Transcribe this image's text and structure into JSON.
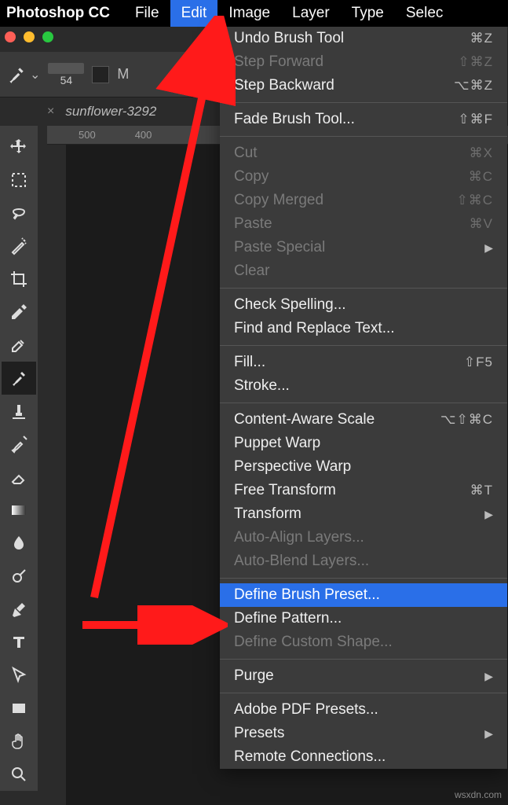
{
  "menubar": {
    "app": "Photoshop CC",
    "items": [
      "File",
      "Edit",
      "Image",
      "Layer",
      "Type",
      "Selec"
    ],
    "activeIndex": 1
  },
  "options": {
    "brushSize": "54",
    "modeLetter": "M"
  },
  "tab": {
    "close": "×",
    "title": "sunflower-3292"
  },
  "ruler": {
    "t0": "500",
    "t1": "400"
  },
  "dropdown": {
    "items": [
      {
        "label": "Undo Brush Tool",
        "shortcut": "⌘Z",
        "enabled": true
      },
      {
        "label": "Step Forward",
        "shortcut": "⇧⌘Z",
        "enabled": false
      },
      {
        "label": "Step Backward",
        "shortcut": "⌥⌘Z",
        "enabled": true
      },
      {
        "sep": true
      },
      {
        "label": "Fade Brush Tool...",
        "shortcut": "⇧⌘F",
        "enabled": true
      },
      {
        "sep": true
      },
      {
        "label": "Cut",
        "shortcut": "⌘X",
        "enabled": false
      },
      {
        "label": "Copy",
        "shortcut": "⌘C",
        "enabled": false
      },
      {
        "label": "Copy Merged",
        "shortcut": "⇧⌘C",
        "enabled": false
      },
      {
        "label": "Paste",
        "shortcut": "⌘V",
        "enabled": false
      },
      {
        "label": "Paste Special",
        "shortcut": "▶",
        "enabled": false
      },
      {
        "label": "Clear",
        "shortcut": "",
        "enabled": false
      },
      {
        "sep": true
      },
      {
        "label": "Check Spelling...",
        "shortcut": "",
        "enabled": true
      },
      {
        "label": "Find and Replace Text...",
        "shortcut": "",
        "enabled": true
      },
      {
        "sep": true
      },
      {
        "label": "Fill...",
        "shortcut": "⇧F5",
        "enabled": true
      },
      {
        "label": "Stroke...",
        "shortcut": "",
        "enabled": true
      },
      {
        "sep": true
      },
      {
        "label": "Content-Aware Scale",
        "shortcut": "⌥⇧⌘C",
        "enabled": true
      },
      {
        "label": "Puppet Warp",
        "shortcut": "",
        "enabled": true
      },
      {
        "label": "Perspective Warp",
        "shortcut": "",
        "enabled": true
      },
      {
        "label": "Free Transform",
        "shortcut": "⌘T",
        "enabled": true
      },
      {
        "label": "Transform",
        "shortcut": "▶",
        "enabled": true
      },
      {
        "label": "Auto-Align Layers...",
        "shortcut": "",
        "enabled": false
      },
      {
        "label": "Auto-Blend Layers...",
        "shortcut": "",
        "enabled": false
      },
      {
        "sep": true
      },
      {
        "label": "Define Brush Preset...",
        "shortcut": "",
        "enabled": true,
        "highlight": true
      },
      {
        "label": "Define Pattern...",
        "shortcut": "",
        "enabled": true
      },
      {
        "label": "Define Custom Shape...",
        "shortcut": "",
        "enabled": false
      },
      {
        "sep": true
      },
      {
        "label": "Purge",
        "shortcut": "▶",
        "enabled": true
      },
      {
        "sep": true
      },
      {
        "label": "Adobe PDF Presets...",
        "shortcut": "",
        "enabled": true
      },
      {
        "label": "Presets",
        "shortcut": "▶",
        "enabled": true
      },
      {
        "label": "Remote Connections...",
        "shortcut": "",
        "enabled": true
      }
    ]
  },
  "tools": [
    "move",
    "marquee",
    "lasso",
    "wand",
    "crop",
    "eyedropper",
    "healing",
    "brush",
    "stamp",
    "history-brush",
    "eraser",
    "gradient",
    "blur",
    "dodge",
    "pen",
    "type",
    "path-select",
    "rectangle",
    "hand",
    "zoom"
  ],
  "toolsSelected": 7,
  "watermark": "wsxdn.com"
}
